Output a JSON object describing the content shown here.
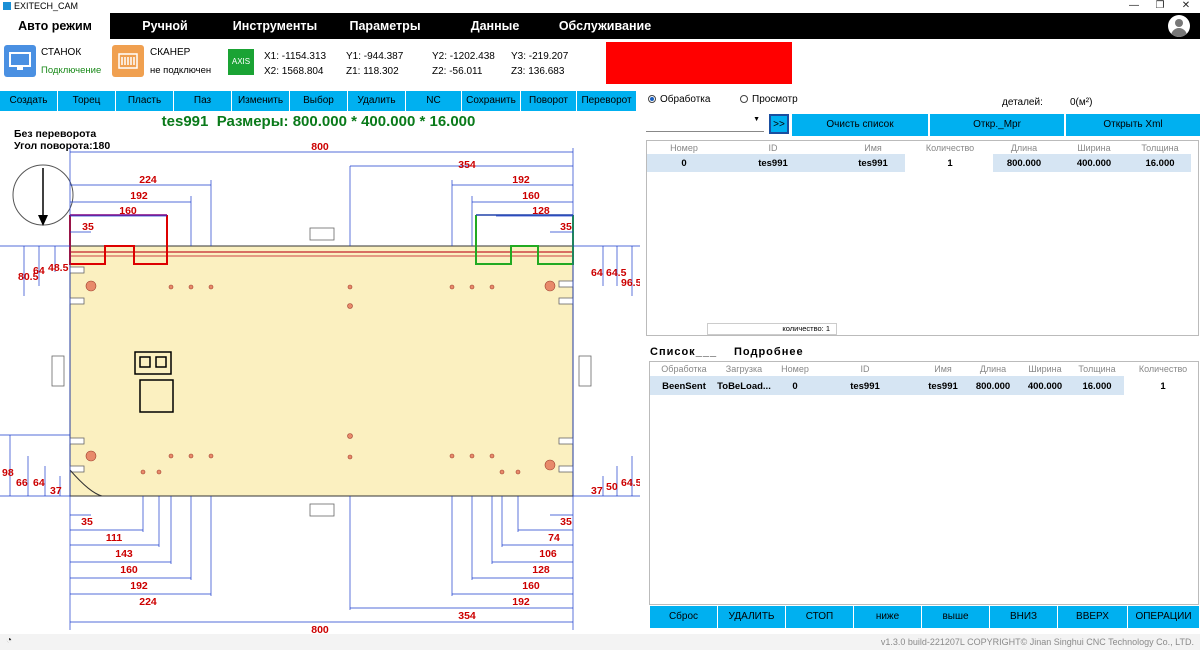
{
  "window": {
    "title": "EXITECH_CAM",
    "minimize": "—",
    "maximize": "❐",
    "close": "✕"
  },
  "menu": [
    {
      "label": "Авто режим",
      "active": true
    },
    {
      "label": "Ручной"
    },
    {
      "label": "Инструменты"
    },
    {
      "label": "Параметры"
    },
    {
      "label": "Данные"
    },
    {
      "label": "Обслуживание"
    }
  ],
  "status": {
    "machine": {
      "name": "СТАНОК",
      "state": "Подключение",
      "state_color": "#1a8a1a",
      "icon_color": "#4a90e2"
    },
    "scanner": {
      "name": "СКАНЕР",
      "state": "не подключен",
      "state_color": "#000000",
      "icon_color": "#f0a050"
    },
    "axis_icon": "AXIS",
    "axes": {
      "x1": "X1:  -1154.313",
      "y1": "Y1:  -944.387",
      "y2": "Y2:  -1202.438",
      "y3": "Y3:  -219.207",
      "x2": "X2:  1568.804",
      "z1": "Z1:  118.302",
      "z2": "Z2:  -56.011",
      "z3": "Z3:  136.683"
    },
    "alarm_color": "#ff0000"
  },
  "toolbar": [
    "Создать",
    "Торец",
    "Пласть",
    "Паз",
    "Изменить",
    "Выбор",
    "Удалить",
    "NC",
    "Сохранить",
    "Поворот",
    "Переворот"
  ],
  "canvas": {
    "part_name": "tes991",
    "size_label": "Размеры: 800.000 * 400.000 * 16.000",
    "flip_note": "Без переворота",
    "rotate_note": "Угол поворота:180",
    "dims_top": {
      "overall": "800",
      "right_354": "354",
      "l224": "224",
      "l192": "192",
      "l160": "160",
      "l35": "35",
      "r192": "192",
      "r160": "160",
      "r128": "128",
      "r35": "35"
    },
    "dims_left": {
      "d805": "80.5",
      "d64": "64",
      "d485": "48.5",
      "d98": "98",
      "d66": "66",
      "d64b": "64",
      "d37": "37"
    },
    "dims_right": {
      "d64": "64",
      "d645": "64.5",
      "d96": "96.5",
      "d37": "37",
      "d50": "50",
      "d64b": "64.5"
    },
    "dims_bottom": {
      "l35": "35",
      "l111": "111",
      "l143": "143",
      "l160": "160",
      "l192": "192",
      "l224": "224",
      "r35": "35",
      "r74": "74",
      "r106": "106",
      "r128": "128",
      "r160": "160",
      "r192": "192",
      "r354": "354",
      "overall": "800"
    }
  },
  "right": {
    "mode_process": "Обработка",
    "mode_view": "Просмотр",
    "parts_label": "деталей:",
    "parts_value": "0(м²)",
    "go_btn": ">>",
    "clear_btn": "Очисть список",
    "open_mpr_btn": "Откр._Mpr",
    "open_xml_btn": "Открыть Xml",
    "top_grid": {
      "headers": [
        "Номер",
        "ID",
        "Имя",
        "Количество",
        "Длина",
        "Ширина",
        "Толщина"
      ],
      "row": [
        "0",
        "tes991",
        "tes991",
        "1",
        "800.000",
        "400.000",
        "16.000"
      ],
      "count_label": "количество: 1"
    },
    "list_label": "Список",
    "detail_label": "Подробнее",
    "bottom_grid": {
      "headers": [
        "Обработка",
        "Загрузка",
        "Номер",
        "ID",
        "Имя",
        "Длина",
        "Ширина",
        "Толщина",
        "Количество"
      ],
      "row": [
        "BeenSent",
        "ToBeLoad...",
        "0",
        "tes991",
        "tes991",
        "800.000",
        "400.000",
        "16.000",
        "1"
      ]
    },
    "bottom_buttons": [
      "Сброс",
      "УДАЛИТЬ",
      "СТОП",
      "ниже",
      "выше",
      "ВНИЗ",
      "ВВЕРХ",
      "ОПЕРАЦИИ"
    ]
  },
  "footer": {
    "copyright": "v1.3.0 build-221207L COPYRIGHT© Jinan Singhui CNC Technology Co., LTD."
  }
}
